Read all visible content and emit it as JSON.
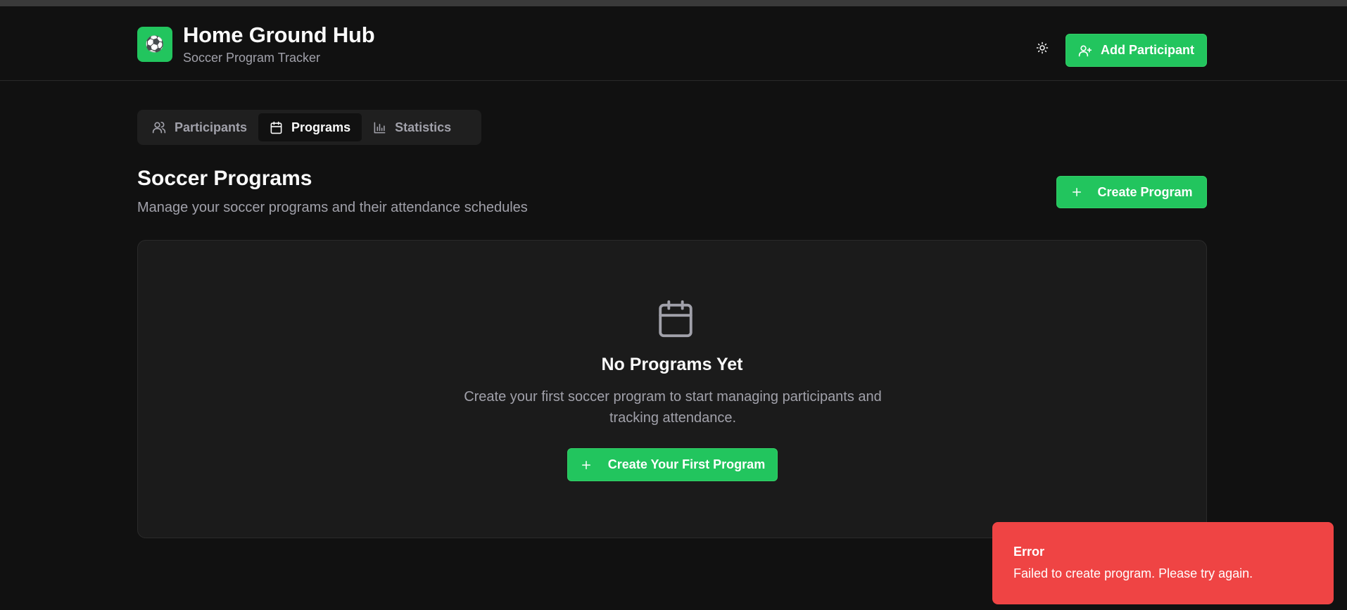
{
  "header": {
    "logo_emoji": "⚽",
    "title": "Home Ground Hub",
    "subtitle": "Soccer Program Tracker",
    "theme_toggle_icon": "sun-icon",
    "add_participant_label": "Add Participant"
  },
  "tabs": [
    {
      "label": "Participants",
      "icon": "users-icon",
      "active": false
    },
    {
      "label": "Programs",
      "icon": "calendar-icon",
      "active": true
    },
    {
      "label": "Statistics",
      "icon": "bar-chart-icon",
      "active": false
    }
  ],
  "section": {
    "title": "Soccer Programs",
    "subtitle": "Manage your soccer programs and their attendance schedules",
    "create_label": "Create Program"
  },
  "empty_state": {
    "icon": "calendar-icon",
    "title": "No Programs Yet",
    "description": "Create your first soccer program to start managing participants and tracking attendance.",
    "button_label": "Create Your First Program"
  },
  "toast": {
    "title": "Error",
    "message": "Failed to create program. Please try again."
  },
  "colors": {
    "accent": "#22c55e",
    "background": "#111111",
    "error": "#ef4444"
  }
}
